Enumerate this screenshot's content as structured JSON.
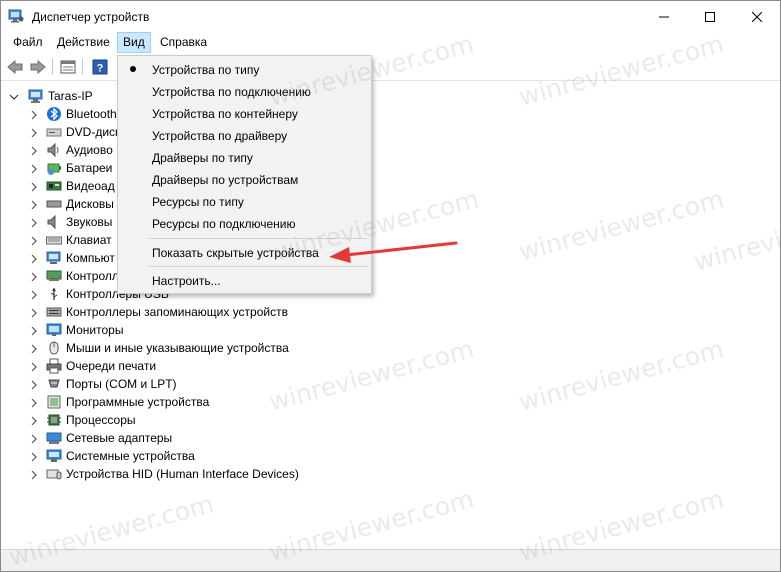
{
  "window": {
    "title": "Диспетчер устройств"
  },
  "menubar": {
    "file": "Файл",
    "action": "Действие",
    "view": "Вид",
    "help": "Справка"
  },
  "tree": {
    "root": "Taras-IP",
    "items": [
      {
        "label": "Bluetooth",
        "icon": "bluetooth-icon"
      },
      {
        "label": "DVD-диск",
        "icon": "dvd-drive-icon"
      },
      {
        "label": "Аудиово",
        "icon": "audio-icon"
      },
      {
        "label": "Батареи",
        "icon": "battery-icon"
      },
      {
        "label": "Видеоад",
        "icon": "display-adapter-icon"
      },
      {
        "label": "Дисковы",
        "icon": "disk-drive-icon"
      },
      {
        "label": "Звуковы",
        "icon": "sound-icon"
      },
      {
        "label": "Клавиат",
        "icon": "keyboard-icon"
      },
      {
        "label": "Компьют",
        "icon": "computer-icon"
      },
      {
        "label": "Контролл",
        "icon": "controller-icon"
      },
      {
        "label": "Контроллеры USB",
        "icon": "usb-icon"
      },
      {
        "label": "Контроллеры запоминающих устройств",
        "icon": "storage-controller-icon"
      },
      {
        "label": "Мониторы",
        "icon": "monitor-icon"
      },
      {
        "label": "Мыши и иные указывающие устройства",
        "icon": "mouse-icon"
      },
      {
        "label": "Очереди печати",
        "icon": "printer-icon"
      },
      {
        "label": "Порты (COM и LPT)",
        "icon": "port-icon"
      },
      {
        "label": "Программные устройства",
        "icon": "software-device-icon"
      },
      {
        "label": "Процессоры",
        "icon": "processor-icon"
      },
      {
        "label": "Сетевые адаптеры",
        "icon": "network-adapter-icon"
      },
      {
        "label": "Системные устройства",
        "icon": "system-device-icon"
      },
      {
        "label": "Устройства HID (Human Interface Devices)",
        "icon": "hid-icon"
      }
    ]
  },
  "view_menu": {
    "items": [
      {
        "label": "Устройства по типу",
        "checked": true
      },
      {
        "label": "Устройства по подключению"
      },
      {
        "label": "Устройства по контейнеру"
      },
      {
        "label": "Устройства по драйверу"
      },
      {
        "label": "Драйверы по типу"
      },
      {
        "label": "Драйверы по устройствам"
      },
      {
        "label": "Ресурсы по типу"
      },
      {
        "label": "Ресурсы по подключению"
      }
    ],
    "show_hidden": "Показать скрытые устройства",
    "customize": "Настроить..."
  },
  "watermark": "winreviewer.com",
  "colors": {
    "menu_highlight": "#cce8ff",
    "arrow": "#e53935",
    "window_border": "#8a8a8a"
  }
}
